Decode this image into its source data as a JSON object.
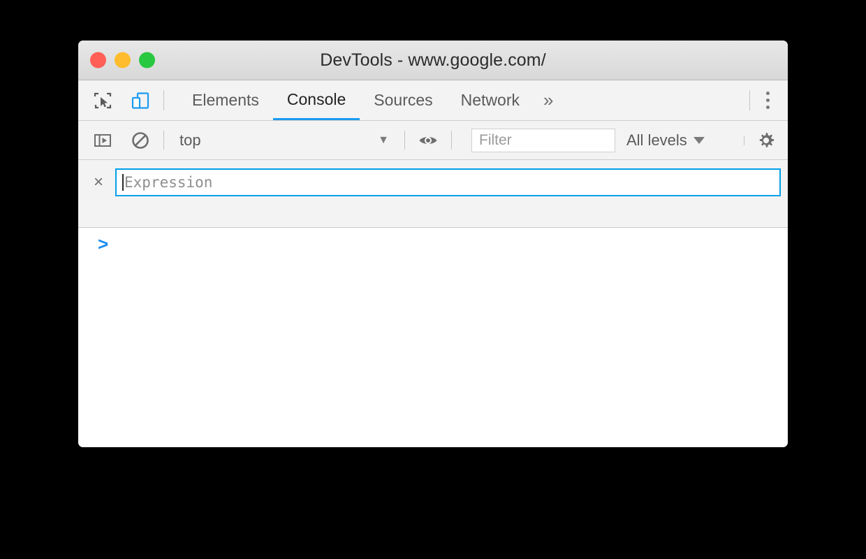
{
  "window": {
    "title": "DevTools - www.google.com/",
    "traffic_lights": [
      {
        "name": "close",
        "color": "#ff5f57"
      },
      {
        "name": "minimize",
        "color": "#ffbd2e"
      },
      {
        "name": "zoom",
        "color": "#28c840"
      }
    ]
  },
  "toolbar_icons": {
    "inspect": "inspect-element-icon",
    "device": "device-toolbar-icon",
    "menu": "more-options-icon"
  },
  "tabs": [
    {
      "label": "Elements",
      "active": false
    },
    {
      "label": "Console",
      "active": true
    },
    {
      "label": "Sources",
      "active": false
    },
    {
      "label": "Network",
      "active": false
    }
  ],
  "tabs_overflow_label": "»",
  "console_toolbar": {
    "sidebar_toggle_icon": "console-sidebar-icon",
    "clear_icon": "clear-console-icon",
    "context": {
      "value": "top",
      "caret": "▼"
    },
    "eye_icon": "live-expression-eye-icon",
    "filter": {
      "placeholder": "Filter",
      "value": ""
    },
    "levels": {
      "label": "All levels"
    },
    "settings_icon": "settings-gear-icon"
  },
  "live_expression": {
    "close_label": "×",
    "placeholder": "Expression",
    "value": ""
  },
  "console": {
    "prompt": ">"
  },
  "colors": {
    "accent": "#1a9bf0",
    "focus_border": "#00a0e9",
    "prompt": "#1a8cf0",
    "toolbar_bg": "#f3f3f3",
    "titlebar_bg": "#e0e0e0"
  }
}
